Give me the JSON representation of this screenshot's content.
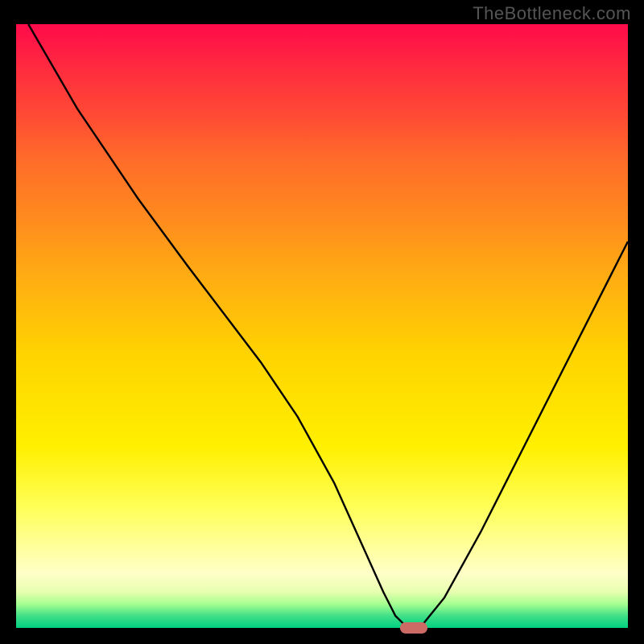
{
  "watermark": "TheBottleneck.com",
  "chart_data": {
    "type": "line",
    "title": "",
    "xlabel": "",
    "ylabel": "",
    "xlim": [
      0,
      100
    ],
    "ylim": [
      0,
      100
    ],
    "x": [
      2,
      10,
      20,
      28,
      34,
      40,
      46,
      52,
      56,
      60,
      62,
      64,
      66,
      70,
      76,
      82,
      90,
      100
    ],
    "values": [
      100,
      86,
      71,
      60,
      52,
      44,
      35,
      24,
      15,
      6,
      2,
      0,
      0,
      5,
      16,
      28,
      44,
      64
    ],
    "marker": {
      "x": 65,
      "y": 0
    }
  },
  "colors": {
    "line": "#000000",
    "marker": "#cc6b66",
    "frame": "#000000"
  }
}
